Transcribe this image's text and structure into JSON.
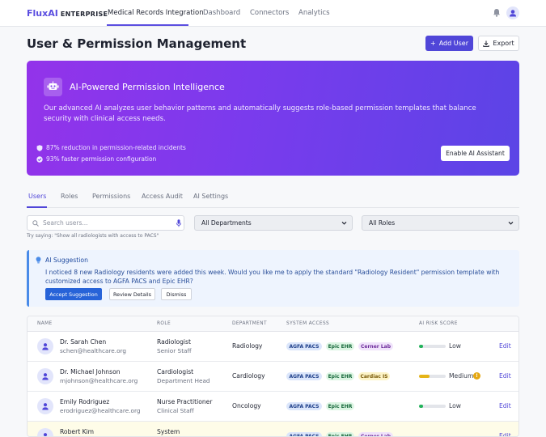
{
  "app": {
    "brand": "FluxAI",
    "brand_sub": "ENTERPRISE"
  },
  "nav": {
    "links": [
      "Medical Records Integration",
      "Dashboard",
      "Connectors",
      "Analytics"
    ],
    "active": "Medical Records Integration",
    "icons": [
      "bell-icon",
      "user-avatar-icon"
    ]
  },
  "page": {
    "title": "User & Permission Management",
    "add_user_label": "Add User",
    "export_label": "Export"
  },
  "hero": {
    "title": "AI-Powered Permission Intelligence",
    "description": "Our advanced AI analyzes user behavior patterns and automatically suggests role-based permission templates that balance security with clinical access needs.",
    "stats": [
      "87% reduction in permission-related incidents",
      "93% faster permission configuration"
    ],
    "button_label": "Enable AI Assistant",
    "icon": "robot-icon"
  },
  "tabs": {
    "items": [
      "Users",
      "Roles",
      "Permissions",
      "Access Audit",
      "AI Settings"
    ],
    "active": "Users"
  },
  "filters": {
    "search_placeholder": "Search users...",
    "search_hint": "Try saying: \"Show all radiologists with access to PACS\"",
    "department": "All Departments",
    "role": "All Roles"
  },
  "suggestion": {
    "title": "AI Suggestion",
    "text": "I noticed 8 new Radiology residents were added this week. Would you like me to apply the standard \"Radiology Resident\" permission template with customized access to AGFA PACS and Epic EHR?",
    "accept_label": "Accept Suggestion",
    "review_label": "Review Details",
    "dismiss_label": "Dismiss"
  },
  "table": {
    "columns": [
      "NAME",
      "ROLE",
      "DEPARTMENT",
      "SYSTEM ACCESS",
      "AI RISK SCORE"
    ],
    "edit_label": "Edit",
    "risk_colors": {
      "Low": "#22b35a",
      "Medium": "#e5b417"
    },
    "rows": [
      {
        "name": "Dr. Sarah Chen",
        "email": "schen@healthcare.org",
        "role": "Radiologist",
        "level": "Senior Staff",
        "department": "Radiology",
        "access": [
          "AGFA PACS",
          "Epic EHR",
          "Cerner Lab"
        ],
        "risk": "Low",
        "risk_value": 0.15
      },
      {
        "name": "Dr. Michael Johnson",
        "email": "mjohnson@healthcare.org",
        "role": "Cardiologist",
        "level": "Department Head",
        "department": "Cardiology",
        "access": [
          "AGFA PACS",
          "Epic EHR",
          "Cardiac IS"
        ],
        "risk": "Medium",
        "risk_value": 0.4
      },
      {
        "name": "Emily Rodriguez",
        "email": "erodriguez@healthcare.org",
        "role": "Nurse Practitioner",
        "level": "Clinical Staff",
        "department": "Oncology",
        "access": [
          "AGFA PACS",
          "Epic EHR"
        ],
        "risk": "Low",
        "risk_value": 0.15
      },
      {
        "name": "Robert Kim",
        "email": "",
        "role": "System",
        "level": "",
        "department": "",
        "access": [
          "AGFA PACS",
          "Epic EHR",
          "Cerner Lab"
        ],
        "risk": "",
        "risk_value": null
      }
    ]
  }
}
